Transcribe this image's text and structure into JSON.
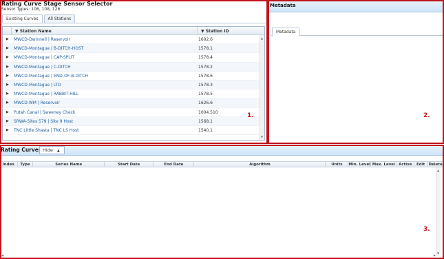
{
  "sensor_selector": {
    "title": "Rating Curve Stage Sensor Selector",
    "subtitle": "Sensor Types: 106, 108, 126",
    "tabs": [
      "Existing Curves",
      "All Stations"
    ],
    "columns": {
      "name": "Station Name",
      "id": "Station ID"
    },
    "rows": [
      {
        "name": "MWCD-Dwinnell | Reservoir",
        "id": "1602.6"
      },
      {
        "name": "MWCD-Montague | B-DITCH-HOST",
        "id": "1578.1"
      },
      {
        "name": "MWCD-Montague | CAP-SPLIT",
        "id": "1578.4"
      },
      {
        "name": "MWCD-Montague | C-DITCH",
        "id": "1578.2"
      },
      {
        "name": "MWCD-Montague | END-OF-B-DITCH",
        "id": "1578.6"
      },
      {
        "name": "MWCD-Montague | LTD",
        "id": "1578.3"
      },
      {
        "name": "MWCD-Montague | RABBIT-HILL",
        "id": "1578.5"
      },
      {
        "name": "MWCD-WM | Reservoir",
        "id": "1626.6"
      },
      {
        "name": "Putah Canal | Sweeney Check",
        "id": "1004.510"
      },
      {
        "name": "SRWA-Sites 579 | Site 9 Host",
        "id": "1568.1"
      },
      {
        "name": "TNC Little Shasta | TNC LS Host",
        "id": "1540.1"
      }
    ],
    "annotation": "1."
  },
  "metadata_panel": {
    "title": "Metadata",
    "tab": "Metadata",
    "annotation": "2."
  },
  "rating_curves": {
    "title": "Rating Curves",
    "hide_label": "Hide",
    "columns": [
      "Index",
      "Type",
      "Series Name",
      "Start Date",
      "End Date",
      "Algorithm",
      "Units",
      "Min. Level",
      "Max. Level",
      "Active",
      "Edit",
      "Delete"
    ],
    "annotation": "3."
  },
  "colors": {
    "highlight_border": "#c0131a",
    "header_blue": "#cfe5f8",
    "link_blue": "#1c5ea0"
  }
}
